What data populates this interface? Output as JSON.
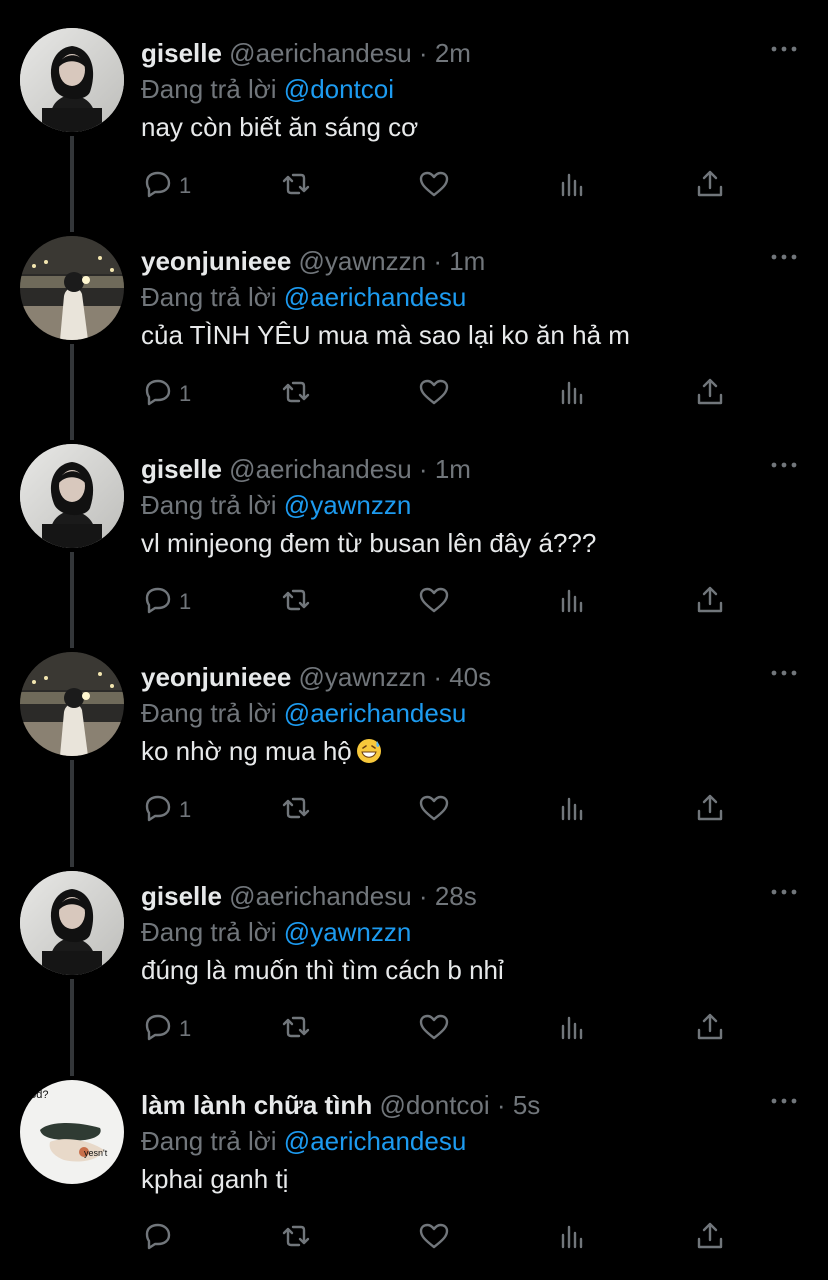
{
  "thread": {
    "tweets": [
      {
        "display_name": "giselle",
        "handle": "@aerichandesu",
        "separator": "·",
        "time": "2m",
        "replying_prefix": "Đang trả lời",
        "replying_to": "@dontcoi",
        "text": "nay còn biết ăn sáng cơ",
        "reply_count": "1",
        "avatar": "giselle-avatar"
      },
      {
        "display_name": "yeonjunieee",
        "handle": "@yawnzzn",
        "separator": "·",
        "time": "1m",
        "replying_prefix": "Đang trả lời",
        "replying_to": "@aerichandesu",
        "text": "của TÌNH YÊU mua mà sao lại ko ăn hả m",
        "reply_count": "1",
        "avatar": "yeonjun-avatar"
      },
      {
        "display_name": "giselle",
        "handle": "@aerichandesu",
        "separator": "·",
        "time": "1m",
        "replying_prefix": "Đang trả lời",
        "replying_to": "@yawnzzn",
        "text": "vl minjeong đem từ busan lên đây á???",
        "reply_count": "1",
        "avatar": "giselle-avatar"
      },
      {
        "display_name": "yeonjunieee",
        "handle": "@yawnzzn",
        "separator": "·",
        "time": "40s",
        "replying_prefix": "Đang trả lời",
        "replying_to": "@aerichandesu",
        "text": "ko nhờ ng mua hộ",
        "emoji": "grinning-sweat-emoji",
        "reply_count": "1",
        "avatar": "yeonjun-avatar"
      },
      {
        "display_name": "giselle",
        "handle": "@aerichandesu",
        "separator": "·",
        "time": "28s",
        "replying_prefix": "Đang trả lời",
        "replying_to": "@yawnzzn",
        "text": "đúng là muốn thì tìm cách b nhỉ",
        "reply_count": "1",
        "avatar": "giselle-avatar"
      },
      {
        "display_name": "làm lành chữa tình",
        "handle": "@dontcoi",
        "separator": "·",
        "time": "5s",
        "replying_prefix": "Đang trả lời",
        "replying_to": "@aerichandesu",
        "text": "kphai ganh tị",
        "reply_count": "",
        "avatar": "dontcoi-avatar",
        "avatar_text_1": "ood?",
        "avatar_text_2": "yesn't"
      }
    ]
  },
  "icons": {
    "reply": "reply-icon",
    "retweet": "retweet-icon",
    "like": "like-icon",
    "views": "views-icon",
    "share": "share-icon",
    "more": "more-icon"
  },
  "colors": {
    "background": "#000000",
    "text": "#e7e9ea",
    "muted": "#71767b",
    "link": "#1d9bf0",
    "thread_line": "#333639"
  }
}
